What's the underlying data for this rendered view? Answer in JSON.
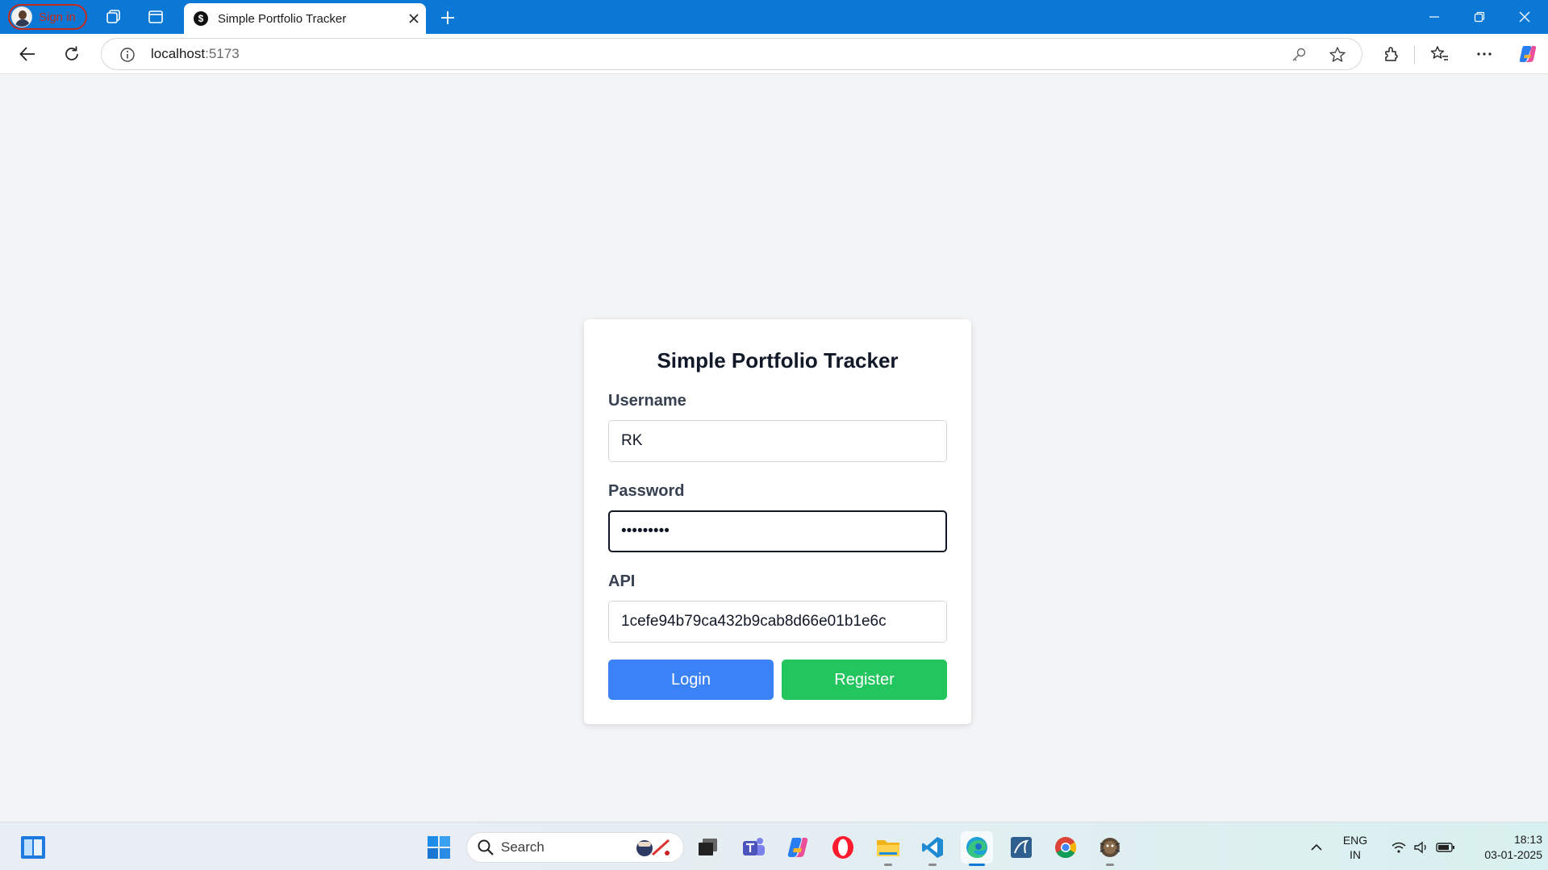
{
  "browser": {
    "profile_label": "Sign in",
    "tab_title": "Simple Portfolio Tracker",
    "tab_favicon_glyph": "$",
    "url_host": "localhost",
    "url_port": ":5173",
    "accent_color": "#0a78d4"
  },
  "login_form": {
    "title": "Simple Portfolio Tracker",
    "username_label": "Username",
    "username_value": "RK",
    "password_label": "Password",
    "password_value": "•••••••••",
    "api_label": "API",
    "api_value": "1cefe94b79ca432b9cab8d66e01b1e6c",
    "login_label": "Login",
    "register_label": "Register",
    "login_color": "#3b82f6",
    "register_color": "#22c55e"
  },
  "taskbar": {
    "search_placeholder": "Search",
    "apps": [
      "start",
      "search",
      "explorer-window",
      "teams",
      "copilot",
      "opera",
      "file-explorer",
      "vscode",
      "edge",
      "mysql-workbench",
      "chrome",
      "bug-app"
    ],
    "language_line1": "ENG",
    "language_line2": "IN",
    "time": "18:13",
    "date": "03-01-2025"
  }
}
